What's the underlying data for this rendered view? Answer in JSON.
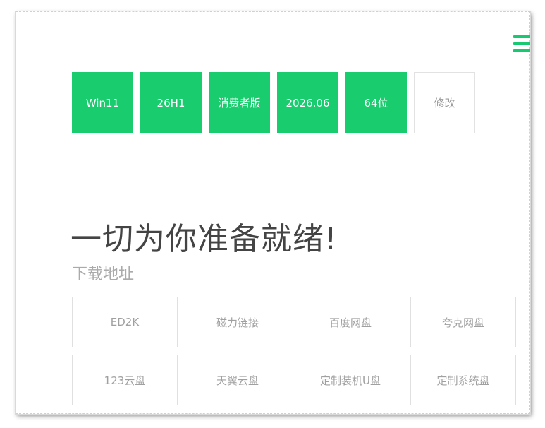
{
  "menu": {
    "icon": "hamburger-menu-icon"
  },
  "tags": [
    "Win11",
    "26H1",
    "消费者版",
    "2026.06",
    "64位"
  ],
  "modify_label": "修改",
  "headline": "一切为你准备就绪!",
  "subhead": "下载地址",
  "downloads": [
    "ED2K",
    "磁力链接",
    "百度网盘",
    "夸克网盘",
    "123云盘",
    "天翼云盘",
    "定制装机U盘",
    "定制系统盘"
  ],
  "colors": {
    "accent": "#19cc6e",
    "muted_text": "#a0a0a0",
    "headline_text": "#444444"
  }
}
